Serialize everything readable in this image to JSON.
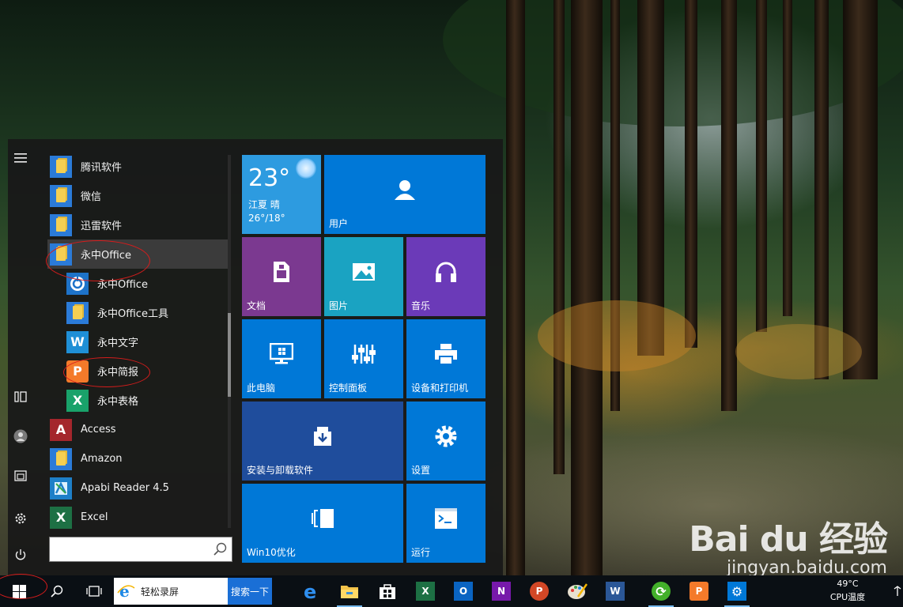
{
  "colors": {
    "accent": "#0078d7",
    "tile_purple": "#7b3990",
    "tile_teal": "#1aa3c2",
    "tile_violet": "#6b3ab8",
    "tile_navy": "#1f4d9c",
    "folder": "#2b7bd8",
    "annotation": "#d61c1c"
  },
  "start_menu": {
    "apps": [
      {
        "label": "腾讯软件",
        "icon": "folder-icon",
        "kind": "folder"
      },
      {
        "label": "微信",
        "icon": "folder-icon",
        "kind": "folder"
      },
      {
        "label": "迅雷软件",
        "icon": "folder-icon",
        "kind": "folder"
      },
      {
        "label": "永中Office",
        "icon": "folder-icon",
        "kind": "folder",
        "expanded": true
      },
      {
        "label": "永中Office",
        "icon": "yozo-office-icon",
        "kind": "sub"
      },
      {
        "label": "永中Office工具",
        "icon": "folder-icon",
        "kind": "sub"
      },
      {
        "label": "永中文字",
        "icon": "yozo-writer-icon",
        "kind": "sub",
        "glyph": "W"
      },
      {
        "label": "永中简报",
        "icon": "yozo-presentation-icon",
        "kind": "sub",
        "glyph": "P"
      },
      {
        "label": "永中表格",
        "icon": "yozo-spreadsheet-icon",
        "kind": "sub",
        "glyph": "X"
      },
      {
        "label": "Access",
        "icon": "access-icon",
        "kind": "app",
        "glyph": "A"
      },
      {
        "label": "Amazon",
        "icon": "folder-icon",
        "kind": "folder"
      },
      {
        "label": "Apabi Reader 4.5",
        "icon": "apabi-reader-icon",
        "kind": "app"
      },
      {
        "label": "Excel",
        "icon": "excel-icon",
        "kind": "app",
        "glyph": "X"
      }
    ],
    "search_placeholder": "",
    "tiles": {
      "weather": {
        "temp": "23°",
        "city": "江夏 晴",
        "range": "26°/18°"
      },
      "user": "用户",
      "documents": "文档",
      "pictures": "图片",
      "music": "音乐",
      "this_pc": "此电脑",
      "control_panel": "控制面板",
      "devices_printers": "设备和打印机",
      "install_uninstall": "安装与卸载软件",
      "settings": "设置",
      "win10_optimize": "Win10优化",
      "run": "运行"
    }
  },
  "taskbar": {
    "search_text": "轻松录屏",
    "search_button": "搜索一下",
    "apps": [
      {
        "name": "edge-icon",
        "glyph": "e"
      },
      {
        "name": "file-explorer-icon",
        "glyph": ""
      },
      {
        "name": "store-icon",
        "glyph": ""
      },
      {
        "name": "excel-icon",
        "glyph": "X"
      },
      {
        "name": "outlook-icon",
        "glyph": "O"
      },
      {
        "name": "onenote-icon",
        "glyph": "N"
      },
      {
        "name": "powerpoint-icon",
        "glyph": "P"
      },
      {
        "name": "paint-icon",
        "glyph": ""
      },
      {
        "name": "word-icon",
        "glyph": "W"
      },
      {
        "name": "refresh-app-icon",
        "glyph": "⟳"
      },
      {
        "name": "yozo-presentation-icon",
        "glyph": "P"
      },
      {
        "name": "settings-icon",
        "glyph": "⚙"
      }
    ],
    "tray": {
      "temperature": "49°C",
      "temperature_label": "CPU温度"
    }
  },
  "watermark": {
    "logo": "Bai du 经验",
    "url": "jingyan.baidu.com"
  }
}
